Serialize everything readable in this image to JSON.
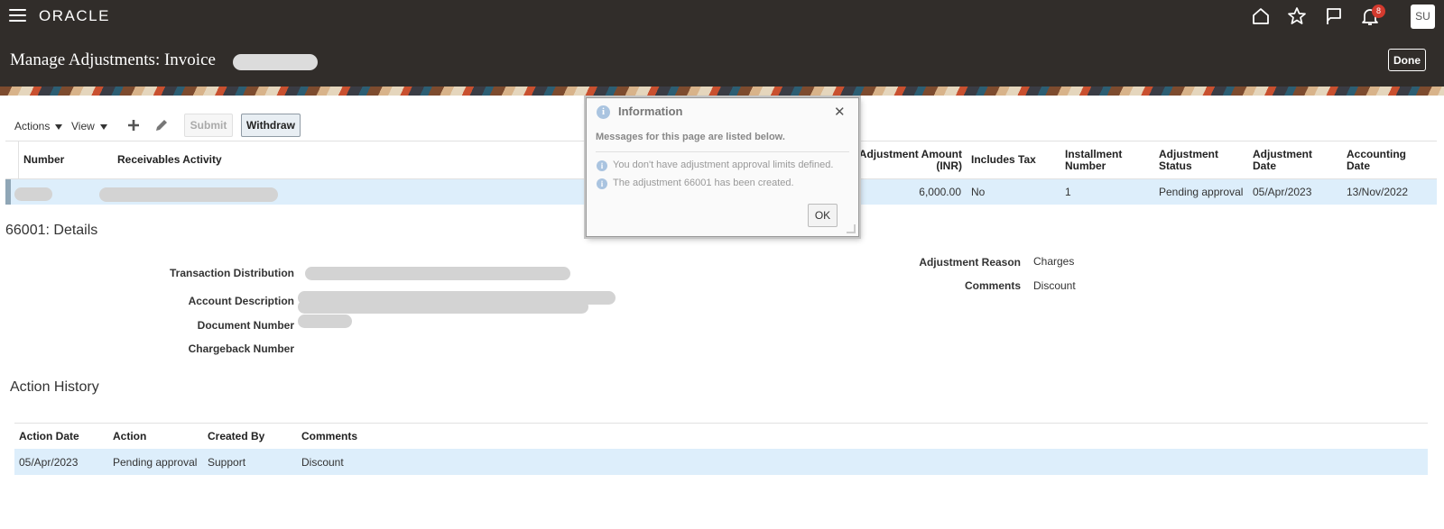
{
  "header": {
    "logo": "ORACLE",
    "notification_count": "8",
    "avatar_initials": "SU"
  },
  "page": {
    "title": "Manage Adjustments: Invoice",
    "done_label": "Done"
  },
  "toolbar": {
    "actions_label": "Actions",
    "view_label": "View",
    "submit_label": "Submit",
    "withdraw_label": "Withdraw"
  },
  "adjustments_table": {
    "headers": {
      "number": "Number",
      "receivables_activity": "Receivables Activity",
      "adjustment_amount": "Adjustment Amount (INR)",
      "includes_tax": "Includes Tax",
      "installment_number": "Installment Number",
      "adjustment_status": "Adjustment Status",
      "adjustment_date": "Adjustment Date",
      "accounting_date": "Accounting Date"
    },
    "row": {
      "adjustment_amount": "6,000.00",
      "includes_tax": "No",
      "installment_number": "1",
      "adjustment_status": "Pending approval",
      "adjustment_date": "05/Apr/2023",
      "accounting_date": "13/Nov/2022"
    }
  },
  "details": {
    "title": "66001: Details",
    "transaction_distribution_label": "Transaction Distribution",
    "account_description_label": "Account Description",
    "document_number_label": "Document Number",
    "chargeback_number_label": "Chargeback Number",
    "adjustment_reason_label": "Adjustment Reason",
    "adjustment_reason_value": "Charges",
    "comments_label": "Comments",
    "comments_value": "Discount"
  },
  "action_history": {
    "title": "Action History",
    "headers": {
      "action_date": "Action Date",
      "action": "Action",
      "created_by": "Created By",
      "comments": "Comments"
    },
    "row": {
      "action_date": "05/Apr/2023",
      "action": "Pending approval",
      "created_by": "Support",
      "comments": "Discount"
    }
  },
  "dialog": {
    "title": "Information",
    "subtitle": "Messages for this page are listed below.",
    "messages": [
      "You don't have adjustment approval limits defined.",
      "The adjustment 66001 has been created."
    ],
    "ok_label": "OK"
  }
}
